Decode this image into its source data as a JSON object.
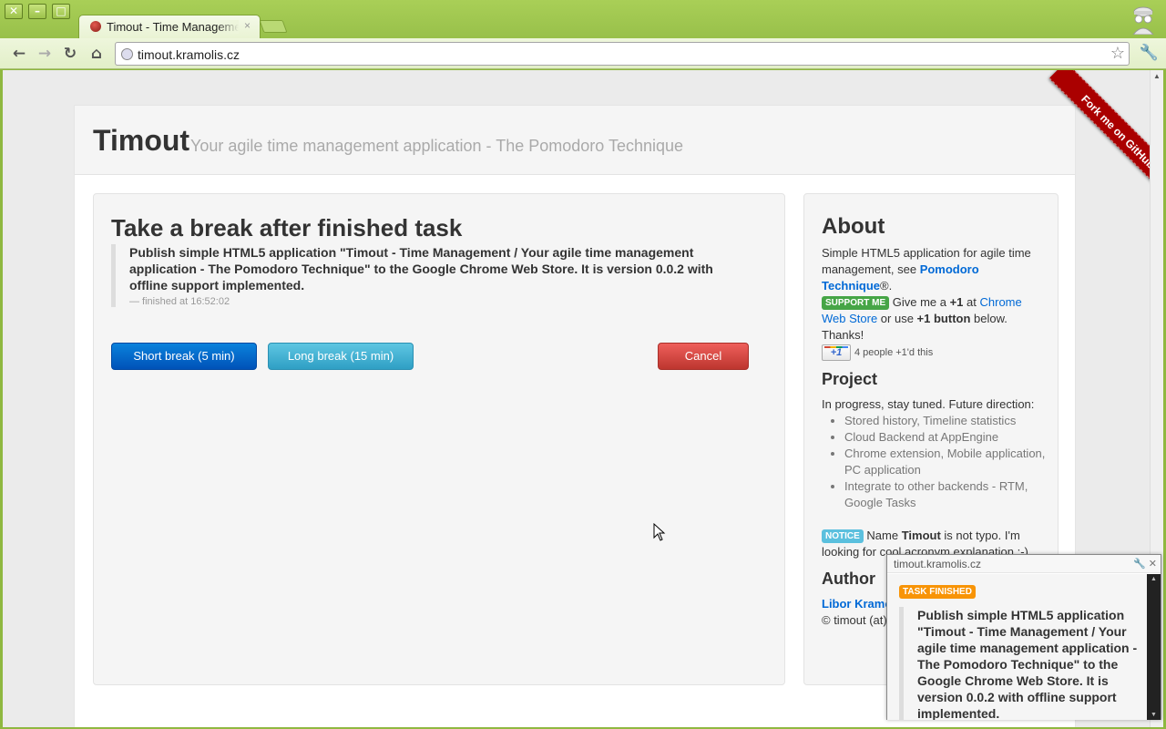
{
  "browser": {
    "tab_title": "Timout - Time Management",
    "tab_close": "×",
    "url": "timout.kramolis.cz"
  },
  "header": {
    "brand": "Timout",
    "tagline": "Your agile time management application - The Pomodoro Technique"
  },
  "main": {
    "heading": "Take a break after finished task",
    "task_text": "Publish simple HTML5 application \"Timout - Time Management / Your agile time management application - The Pomodoro Technique\" to the Google Chrome Web Store. It is version 0.0.2 with offline support implemented.",
    "finished_text": "— finished at 16:52:02",
    "short_break_label": "Short break (5 min)",
    "long_break_label": "Long break (15 min)",
    "cancel_label": "Cancel"
  },
  "sidebar": {
    "about_heading": "About",
    "about_p1": "Simple HTML5 application for agile time management, see ",
    "pomodoro_link": "Pomodoro Technique",
    "about_p1_end": "®.",
    "support_label": "SUPPORT ME",
    "support_p1": " Give me a ",
    "plus1": "+1",
    "support_p2": " at ",
    "cws_link": "Chrome Web Store",
    "support_p3": " or use ",
    "plus1_button_text": "+1 button",
    "support_p4": " below. Thanks!",
    "plusone_badge": "+1",
    "plusone_count": "4 people +1'd this",
    "project_heading": "Project",
    "project_intro": "In progress, stay tuned. Future direction:",
    "project_items": [
      "Stored history, Timeline statistics",
      "Cloud Backend at AppEngine",
      "Chrome extension, Mobile application, PC application",
      "Integrate to other backends - RTM, Google Tasks"
    ],
    "notice_label": "NOTICE",
    "notice_p1": " Name ",
    "notice_name": "Timout",
    "notice_p2": " is not typo. I'm looking for cool acronym explanation ;-)",
    "author_heading": "Author",
    "author_link": "Libor Kramolis",
    "author_email": "© timout (at) kramolis.cz"
  },
  "ribbon": {
    "text": "Fork me on GitHub"
  },
  "notification": {
    "origin": "timout.kramolis.cz",
    "label": "TASK FINISHED",
    "text": "Publish simple HTML5 application \"Timout - Time Management / Your agile time management application - The Pomodoro Technique\" to the Google Chrome Web Store. It is version 0.0.2 with offline support implemented."
  },
  "colors": {
    "chrome_theme": "#98c04a",
    "primary": "#0052b8",
    "info": "#2f9fc4",
    "danger": "#bd362f",
    "success_label": "#46a546",
    "info_label": "#5bc0de",
    "warning_label": "#f89406",
    "ribbon": "#aa0000"
  },
  "icons": [
    "close-icon",
    "minimize-icon",
    "maximize-icon",
    "back-icon",
    "forward-icon",
    "reload-icon",
    "home-icon",
    "globe-icon",
    "star-icon",
    "wrench-icon",
    "incognito-icon",
    "mouse-cursor-icon"
  ]
}
